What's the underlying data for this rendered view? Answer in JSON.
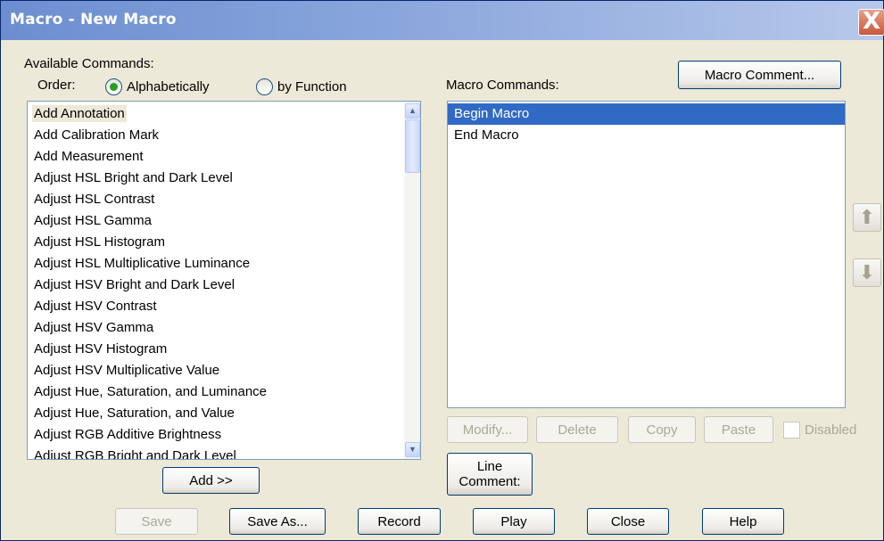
{
  "window": {
    "title": "Macro - New Macro",
    "close_glyph": "X"
  },
  "left": {
    "available_label": "Available Commands:",
    "order_label": "Order:",
    "radio_alpha_label": "Alphabetically",
    "radio_function_label": "by Function",
    "selected_order": "Alphabetically",
    "items": [
      "Add Annotation",
      "Add Calibration Mark",
      "Add Measurement",
      "Adjust HSL Bright and Dark Level",
      "Adjust HSL Contrast",
      "Adjust HSL Gamma",
      "Adjust HSL Histogram",
      "Adjust HSL Multiplicative Luminance",
      "Adjust HSV Bright and Dark Level",
      "Adjust HSV Contrast",
      "Adjust HSV Gamma",
      "Adjust HSV Histogram",
      "Adjust HSV Multiplicative Value",
      "Adjust Hue, Saturation, and Luminance",
      "Adjust Hue, Saturation, and Value",
      "Adjust RGB Additive Brightness",
      "Adjust RGB Bright and Dark Level"
    ],
    "add_button": "Add >>"
  },
  "right": {
    "macro_comment_button": "Macro Comment...",
    "macro_commands_label": "Macro Commands:",
    "items": [
      "Begin Macro",
      "End Macro"
    ],
    "selected_item": "Begin Macro",
    "modify_button": "Modify...",
    "delete_button": "Delete",
    "copy_button": "Copy",
    "paste_button": "Paste",
    "disabled_label": "Disabled",
    "line_comment_button_line1": "Line",
    "line_comment_button_line2": "Comment:",
    "move_up_icon": "arrow-up",
    "move_down_icon": "arrow-down"
  },
  "footer": {
    "save": "Save",
    "save_as": "Save As...",
    "record": "Record",
    "play": "Play",
    "close": "Close",
    "help": "Help"
  },
  "colors": {
    "selection": "#316ac5",
    "radio_checked": "#21a121",
    "title_bar": "#6c8ed0"
  }
}
